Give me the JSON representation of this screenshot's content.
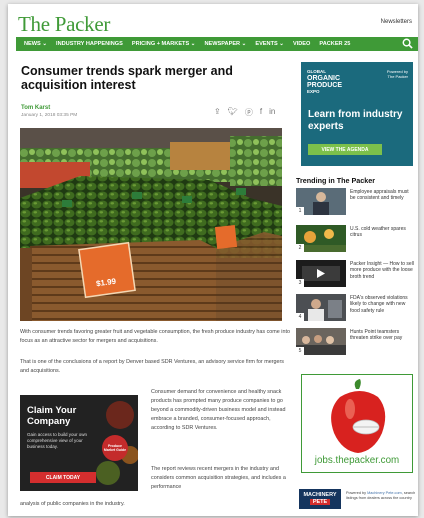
{
  "header": {
    "logo": "The Packer",
    "newsletters": "Newsletters"
  },
  "nav": {
    "items": [
      "NEWS ⌄",
      "INDUSTRY HAPPENINGS",
      "PRICING + MARKETS ⌄",
      "NEWSPAPER ⌄",
      "EVENTS ⌄",
      "VIDEO",
      "PACKER 25"
    ]
  },
  "article": {
    "headline": "Consumer trends spark merger and acquisition interest",
    "author": "Tom Karst",
    "date": "January 1, 2018 03:35 PM",
    "hero_sign_text": "$1.99",
    "p1": "With consumer trends favoring greater fruit and vegetable consumption, the fresh produce industry has come into focus as an attractive sector for mergers and acquisitions.",
    "p2_pre": "That is one of the conclusions of a report by Denver based SDR Ventures, an ",
    "p2_link": "advisory service firm for mergers and acquisitions.",
    "p3": "Consumer demand for convenience and healthy snack products has prompted many produce companies to go beyond a commodity-driven business model and instead embrace a branded, consumer-focused approach, according to SDR Ventures.",
    "p4": "The report reviews recent mergers in the industry and considers common acquisition strategies, and includes a performance",
    "p5": "analysis of public companies in the industry."
  },
  "ad_claim": {
    "title_line1": "Claim Your",
    "title_line2": "Company",
    "body": "Gain access to build your own comprehensive view of your business today.",
    "badge": "Produce Market Guide",
    "button": "CLAIM TODAY"
  },
  "ad_gop": {
    "brand_small_top": "GLOBAL",
    "brand_big_1": "ORGANIC",
    "brand_big_2": "PRODUCE",
    "brand_small_bottom": "EXPO",
    "powered_by": "Powered by",
    "powered_brand": "The Packer",
    "headline": "Learn from industry experts",
    "button": "VIEW THE AGENDA"
  },
  "trending": {
    "title": "Trending in The Packer",
    "items": [
      {
        "num": "1",
        "text": "Employee appraisals must be consistent and timely"
      },
      {
        "num": "2",
        "text": "U.S. cold weather spares citrus"
      },
      {
        "num": "3",
        "text": "Packer Insight — How to sell more produce with the loose broth trend"
      },
      {
        "num": "4",
        "text": "FDA's observed violations likely to change with new food safety rule"
      },
      {
        "num": "5",
        "text": "Hunts Point teamsters threaten strike over pay"
      }
    ]
  },
  "ad_jobs": {
    "url": "jobs.thepacker.com"
  },
  "machinery_pete": {
    "logo_line1": "MACHINERY",
    "logo_line2": "PETE",
    "text_pre": "Powered by ",
    "text_link": "Machinery Pete.com",
    "text_post": ", search listings from dealers across the country"
  },
  "colors": {
    "brand_green": "#3f9a37",
    "ad_red": "#d42e2e",
    "gop_teal": "#1b6a7d"
  }
}
